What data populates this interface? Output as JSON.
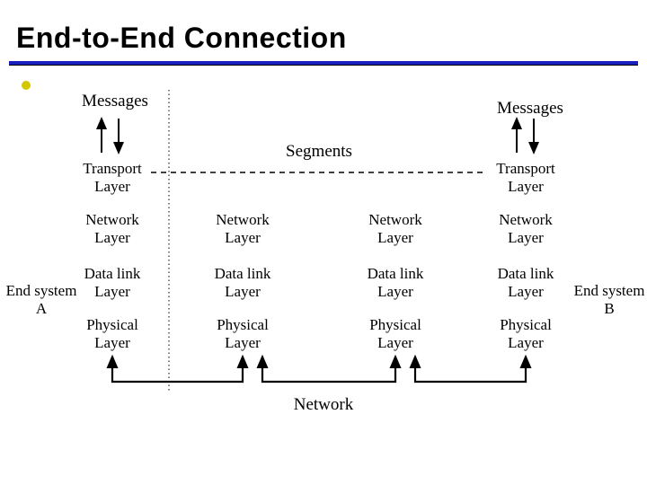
{
  "title": "End-to-End Connection",
  "messages_left": "Messages",
  "messages_right": "Messages",
  "segments": "Segments",
  "transport_left": "Transport\nLayer",
  "transport_right": "Transport\nLayer",
  "network_a": "Network\nLayer",
  "network_r1": "Network\nLayer",
  "network_r2": "Network\nLayer",
  "network_b": "Network\nLayer",
  "datalink_a": "Data link\nLayer",
  "datalink_r1": "Data link\nLayer",
  "datalink_r2": "Data link\nLayer",
  "datalink_b": "Data link\nLayer",
  "physical_a": "Physical\nLayer",
  "physical_r1": "Physical\nLayer",
  "physical_r2": "Physical\nLayer",
  "physical_b": "Physical\nLayer",
  "end_a": "End system\nA",
  "end_b": "End system\nB",
  "network_label": "Network"
}
